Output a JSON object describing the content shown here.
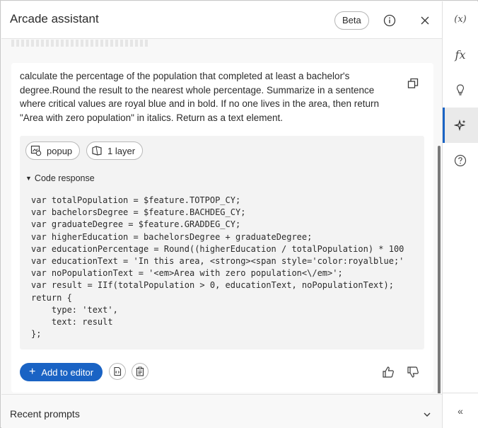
{
  "header": {
    "title": "Arcade assistant",
    "badge": "Beta",
    "info_icon": "info-circle",
    "close_icon": "close-x"
  },
  "card": {
    "prompt": "calculate the percentage of the population that completed at least a bachelor's degree.Round the result to the nearest whole percentage. Summarize in a sentence where critical values are royal blue and in bold. If no one lives in the area, then return \"Area with zero population\" in italics. Return as a text element.",
    "chips": [
      {
        "label": "popup",
        "icon": "popup-icon"
      },
      {
        "label": "1 layer",
        "icon": "layer-icon"
      }
    ],
    "code_toggle": "Code response",
    "code": "var totalPopulation = $feature.TOTPOP_CY;\nvar bachelorsDegree = $feature.BACHDEG_CY;\nvar graduateDegree = $feature.GRADDEG_CY;\nvar higherEducation = bachelorsDegree + graduateDegree;\nvar educationPercentage = Round((higherEducation / totalPopulation) * 100\nvar educationText = 'In this area, <strong><span style='color:royalblue;'\nvar noPopulationText = '<em>Area with zero population<\\/em>';\nvar result = IIf(totalPopulation > 0, educationText, noPopulationText);\nreturn {\n    type: 'text',\n    text: result\n};",
    "add_button": "Add to editor"
  },
  "recent": {
    "label": "Recent prompts"
  },
  "rail": {
    "items": [
      {
        "label": "(x)",
        "name": "variables"
      },
      {
        "label": "fx",
        "name": "functions"
      },
      {
        "label": "",
        "name": "suggestions"
      },
      {
        "label": "",
        "name": "assistant"
      },
      {
        "label": "",
        "name": "help"
      }
    ],
    "collapse": "«"
  },
  "colors": {
    "accent": "#1a63c4",
    "panel_bg": "#f8f8f8",
    "code_bg": "#f3f3f3"
  }
}
